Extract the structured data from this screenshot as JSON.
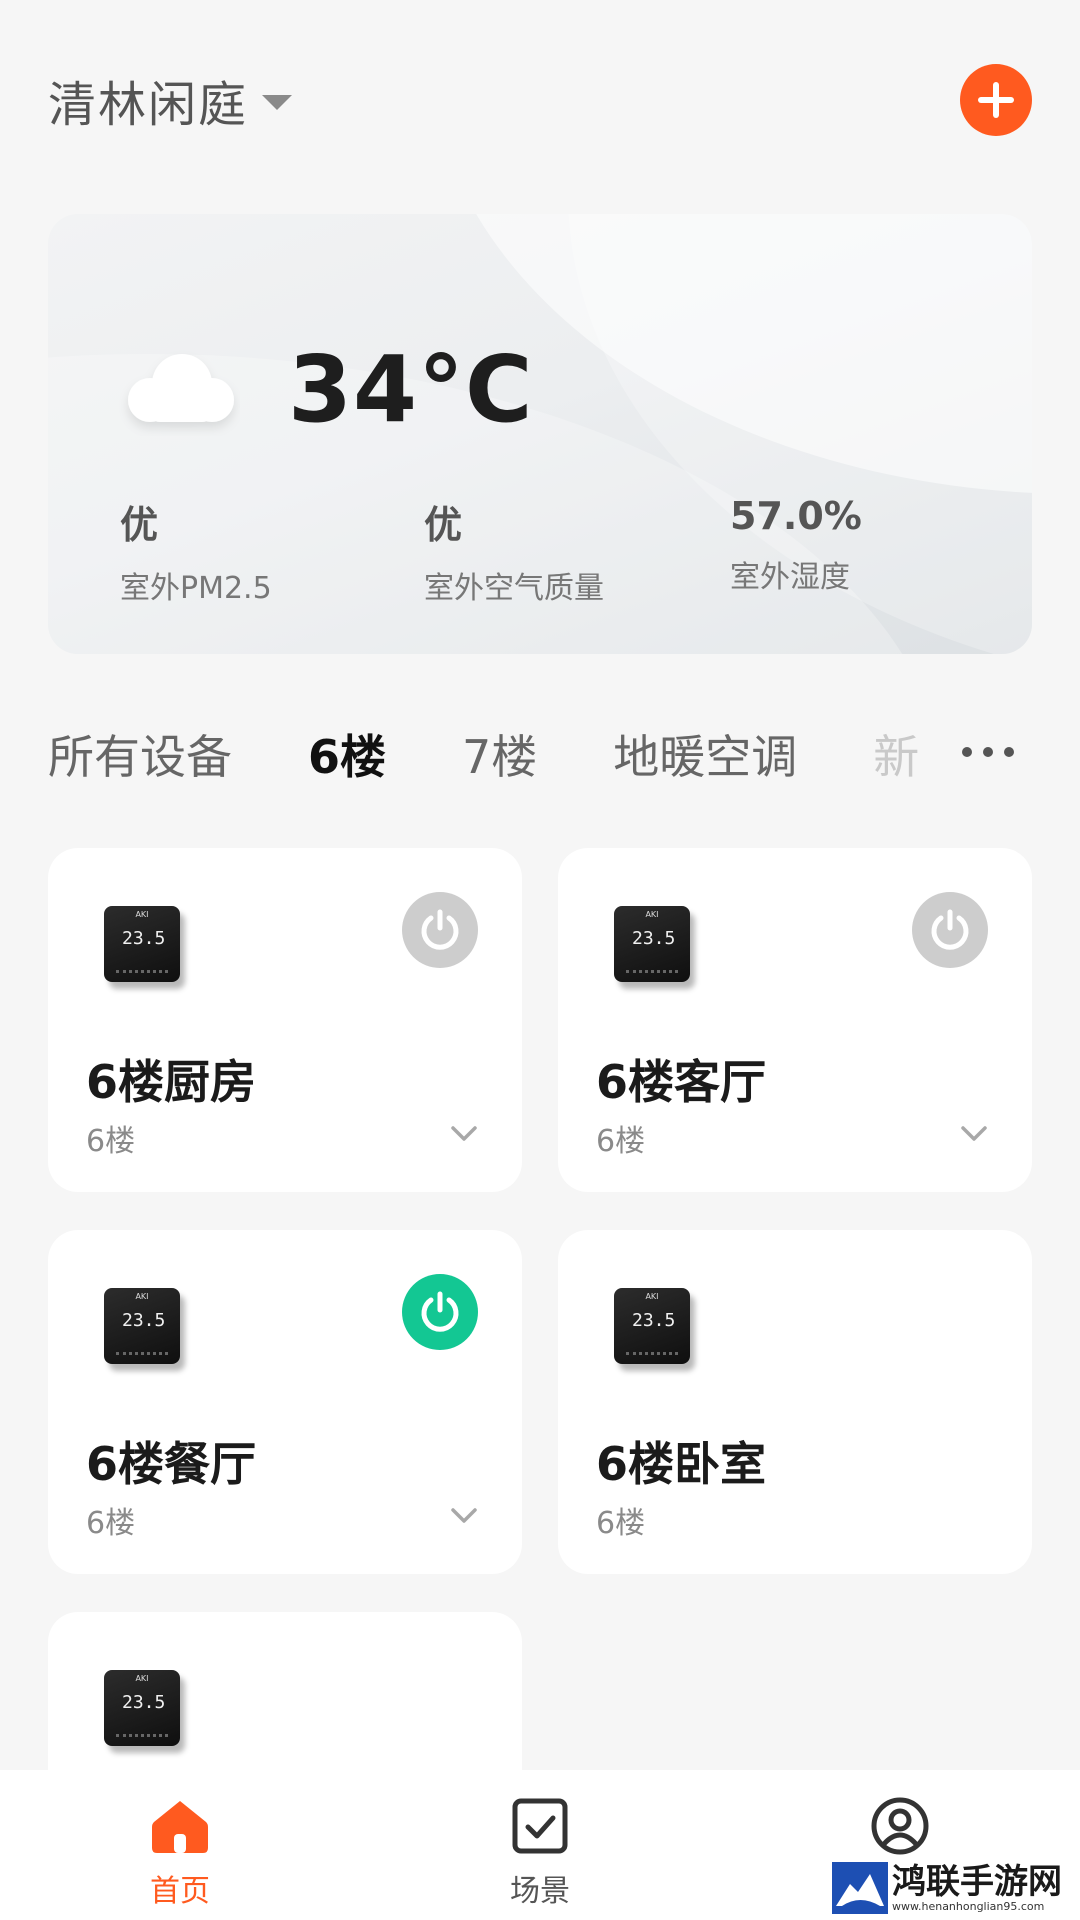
{
  "header": {
    "home_name": "清林闲庭"
  },
  "weather": {
    "temperature": "34°C",
    "stats": [
      {
        "value": "优",
        "label": "室外PM2.5"
      },
      {
        "value": "优",
        "label": "室外空气质量"
      },
      {
        "value": "57.0%",
        "label": "室外湿度"
      }
    ]
  },
  "tabs": [
    {
      "label": "所有设备",
      "active": false
    },
    {
      "label": "6楼",
      "active": true
    },
    {
      "label": "7楼",
      "active": false
    },
    {
      "label": "地暖空调",
      "active": false
    },
    {
      "label": "新",
      "active": false
    }
  ],
  "devices": [
    {
      "name": "6楼厨房",
      "floor": "6楼",
      "thermo_brand": "AKI",
      "thermo_reading": "23.5",
      "power": "off"
    },
    {
      "name": "6楼客厅",
      "floor": "6楼",
      "thermo_brand": "AKI",
      "thermo_reading": "23.5",
      "power": "off"
    },
    {
      "name": "6楼餐厅",
      "floor": "6楼",
      "thermo_brand": "AKI",
      "thermo_reading": "23.5",
      "power": "on"
    },
    {
      "name": "6楼卧室",
      "floor": "6楼",
      "thermo_brand": "AKI",
      "thermo_reading": "23.5",
      "power": "none"
    },
    {
      "name": "",
      "floor": "",
      "thermo_brand": "AKI",
      "thermo_reading": "23.5",
      "power": "none"
    }
  ],
  "nav": [
    {
      "label": "首页",
      "icon": "home-icon",
      "active": true
    },
    {
      "label": "场景",
      "icon": "scene-check-icon",
      "active": false
    },
    {
      "label": "",
      "icon": "profile-icon",
      "active": false
    }
  ],
  "watermark": {
    "text": "鸿联手游网",
    "url": "www.henanhonglian95.com"
  },
  "colors": {
    "accent": "#ff5a1f",
    "power_on": "#13c793",
    "power_off": "#cdcdcd"
  }
}
